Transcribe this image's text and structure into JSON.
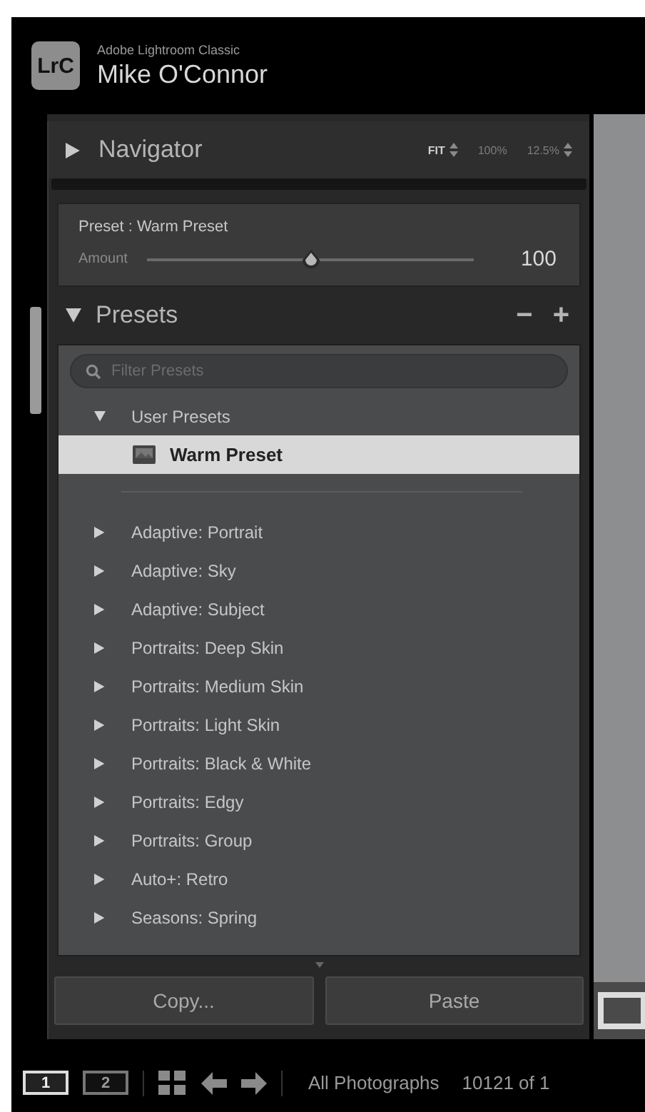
{
  "title_bar": {
    "app_name": "Adobe Lightroom Classic",
    "user_name": "Mike O'Connor",
    "logo": "LrC"
  },
  "navigator": {
    "title": "Navigator",
    "expanded": false,
    "zoom_options": [
      {
        "label": "FIT",
        "selected": true,
        "stepper": true
      },
      {
        "label": "100%",
        "selected": false,
        "stepper": false
      },
      {
        "label": "12.5%",
        "selected": false,
        "stepper": true
      }
    ]
  },
  "preset_amount": {
    "label": "Preset : Warm Preset",
    "slider_label": "Amount",
    "level": 0.5,
    "reading": "100"
  },
  "presets": {
    "title": "Presets",
    "expanded": true,
    "remove": "−",
    "add": "+",
    "search": {
      "placeholder": "Filter Presets"
    },
    "tree": [
      {
        "label": "User Presets",
        "expanded": true,
        "selected": false,
        "children": [
          {
            "label": "Warm Preset",
            "selected": true
          }
        ]
      },
      {
        "label": "Adaptive: Portrait",
        "expanded": false,
        "selected": false
      },
      {
        "label": "Adaptive: Sky",
        "expanded": false,
        "selected": false
      },
      {
        "label": "Adaptive: Subject",
        "expanded": false,
        "selected": false
      },
      {
        "label": "Portraits: Deep Skin",
        "expanded": false,
        "selected": false
      },
      {
        "label": "Portraits: Medium Skin",
        "expanded": false,
        "selected": false
      },
      {
        "label": "Portraits: Light Skin",
        "expanded": false,
        "selected": false
      },
      {
        "label": "Portraits: Black & White",
        "expanded": false,
        "selected": false
      },
      {
        "label": "Portraits: Edgy",
        "expanded": false,
        "selected": false
      },
      {
        "label": "Portraits: Group",
        "expanded": false,
        "selected": false
      },
      {
        "label": "Auto+: Retro",
        "expanded": false,
        "selected": false
      },
      {
        "label": "Seasons: Spring",
        "expanded": false,
        "selected": false
      }
    ]
  },
  "buttons": [
    "Copy...",
    "Paste"
  ],
  "filmstrip": {
    "windows": [
      {
        "label": "1",
        "selected": true
      },
      {
        "label": "2",
        "selected": false
      }
    ],
    "source": "All Photographs",
    "count": "10121 of 1"
  }
}
